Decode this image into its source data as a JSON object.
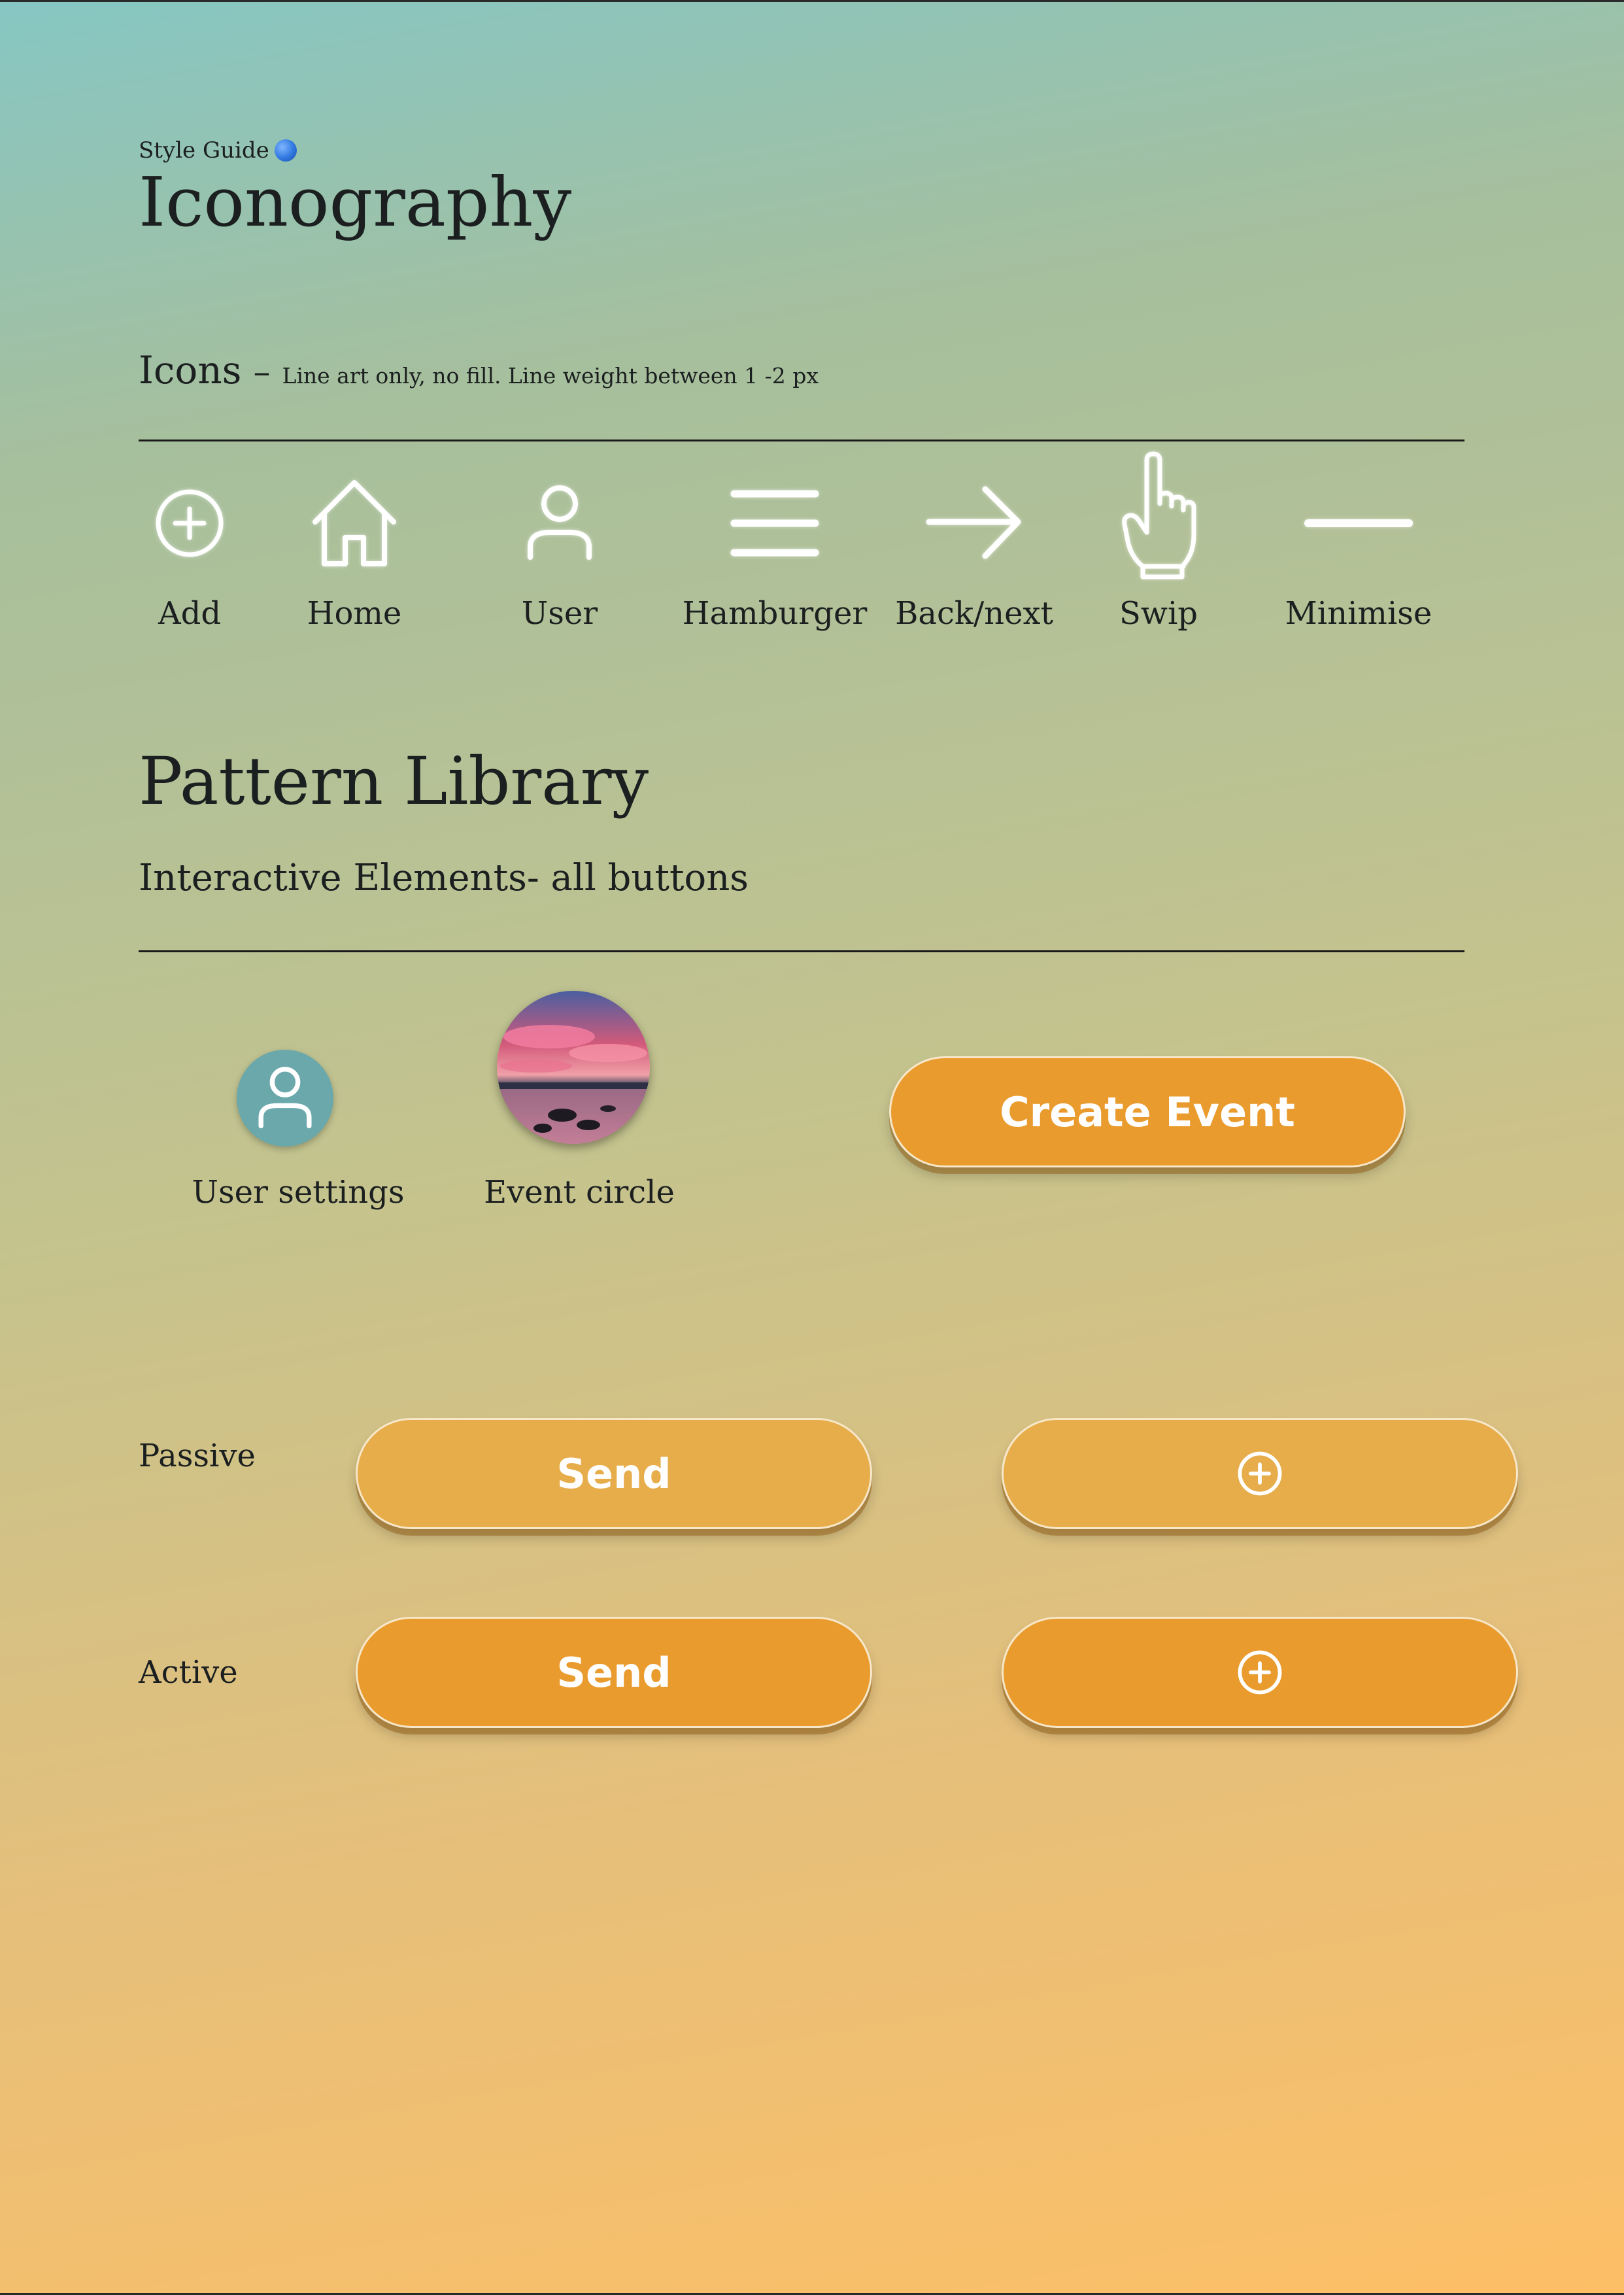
{
  "header": {
    "eyebrow": "Style Guide",
    "title": "Iconography"
  },
  "icons_section": {
    "heading": "Icons",
    "dash": "–",
    "note": "Line art only, no fill. Line weight between 1 -2 px",
    "items": [
      {
        "label": "Add",
        "icon": "add-circle-icon"
      },
      {
        "label": "Home",
        "icon": "home-icon"
      },
      {
        "label": "User",
        "icon": "user-icon"
      },
      {
        "label": "Hamburger",
        "icon": "hamburger-icon"
      },
      {
        "label": "Back/next",
        "icon": "arrow-right-icon"
      },
      {
        "label": "Swip",
        "icon": "hand-pointer-icon"
      },
      {
        "label": "Minimise",
        "icon": "minus-icon"
      }
    ]
  },
  "pattern_library": {
    "title": "Pattern Library",
    "subtitle": "Interactive Elements- all buttons",
    "user_settings_label": "User settings",
    "event_circle_label": "Event circle",
    "create_event_label": "Create Event",
    "passive_label": "Passive",
    "active_label": "Active",
    "send_label": "Send"
  },
  "colors": {
    "button_active": "#e99b2e",
    "button_passive": "#e6ad4a",
    "user_circle": "#6aa8ac",
    "gradient_top": "#86c6c3",
    "gradient_bottom": "#fdbf66"
  }
}
